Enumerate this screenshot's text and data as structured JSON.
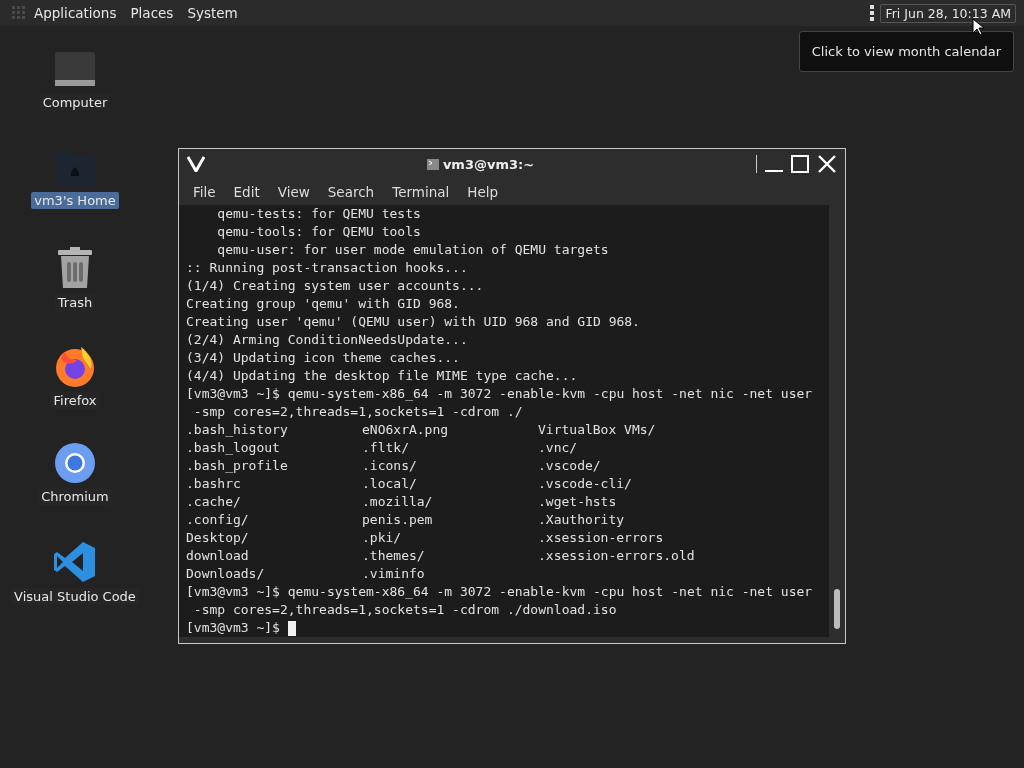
{
  "top_panel": {
    "menus": [
      "Applications",
      "Places",
      "System"
    ],
    "clock": "Fri Jun 28, 10:13 AM",
    "tooltip": "Click to view month calendar"
  },
  "desktop_icons": [
    {
      "kind": "computer",
      "label": "Computer",
      "selected": false
    },
    {
      "kind": "home",
      "label": "vm3's Home",
      "selected": true
    },
    {
      "kind": "trash",
      "label": "Trash",
      "selected": false
    },
    {
      "kind": "firefox",
      "label": "Firefox",
      "selected": false
    },
    {
      "kind": "chromium",
      "label": "Chromium",
      "selected": false
    },
    {
      "kind": "vscode",
      "label": "Visual Studio Code",
      "selected": false
    }
  ],
  "terminal": {
    "title": "vm3@vm3:~",
    "menu": [
      "File",
      "Edit",
      "View",
      "Search",
      "Terminal",
      "Help"
    ],
    "lines": [
      {
        "kind": "text",
        "text": "    qemu-tests: for QEMU tests"
      },
      {
        "kind": "text",
        "text": "    qemu-tools: for QEMU tools"
      },
      {
        "kind": "text",
        "text": "    qemu-user: for user mode emulation of QEMU targets"
      },
      {
        "kind": "text",
        "text": ":: Running post-transaction hooks..."
      },
      {
        "kind": "text",
        "text": "(1/4) Creating system user accounts..."
      },
      {
        "kind": "text",
        "text": "Creating group 'qemu' with GID 968."
      },
      {
        "kind": "text",
        "text": "Creating user 'qemu' (QEMU user) with UID 968 and GID 968."
      },
      {
        "kind": "text",
        "text": "(2/4) Arming ConditionNeedsUpdate..."
      },
      {
        "kind": "text",
        "text": "(3/4) Updating icon theme caches..."
      },
      {
        "kind": "text",
        "text": "(4/4) Updating the desktop file MIME type cache..."
      },
      {
        "kind": "text",
        "text": "[vm3@vm3 ~]$ qemu-system-x86_64 -m 3072 -enable-kvm -cpu host -net nic -net user"
      },
      {
        "kind": "text",
        "text": " -smp cores=2,threads=1,sockets=1 -cdrom ./"
      },
      {
        "kind": "columns",
        "cells": [
          ".bash_history",
          "eNO6xrA.png",
          "VirtualBox VMs/"
        ]
      },
      {
        "kind": "columns",
        "cells": [
          ".bash_logout",
          ".fltk/",
          ".vnc/"
        ]
      },
      {
        "kind": "columns",
        "cells": [
          ".bash_profile",
          ".icons/",
          ".vscode/"
        ]
      },
      {
        "kind": "columns",
        "cells": [
          ".bashrc",
          ".local/",
          ".vscode-cli/"
        ]
      },
      {
        "kind": "columns",
        "cells": [
          ".cache/",
          ".mozilla/",
          ".wget-hsts"
        ]
      },
      {
        "kind": "columns",
        "cells": [
          ".config/",
          "penis.pem",
          ".Xauthority"
        ]
      },
      {
        "kind": "columns",
        "cells": [
          "Desktop/",
          ".pki/",
          ".xsession-errors"
        ]
      },
      {
        "kind": "columns",
        "cells": [
          "download",
          ".themes/",
          ".xsession-errors.old"
        ]
      },
      {
        "kind": "columns",
        "cells": [
          "Downloads/",
          ".viminfo"
        ]
      },
      {
        "kind": "text",
        "text": "[vm3@vm3 ~]$ qemu-system-x86_64 -m 3072 -enable-kvm -cpu host -net nic -net user"
      },
      {
        "kind": "text",
        "text": " -smp cores=2,threads=1,sockets=1 -cdrom ./download.iso"
      },
      {
        "kind": "prompt",
        "text": "[vm3@vm3 ~]$"
      }
    ]
  }
}
